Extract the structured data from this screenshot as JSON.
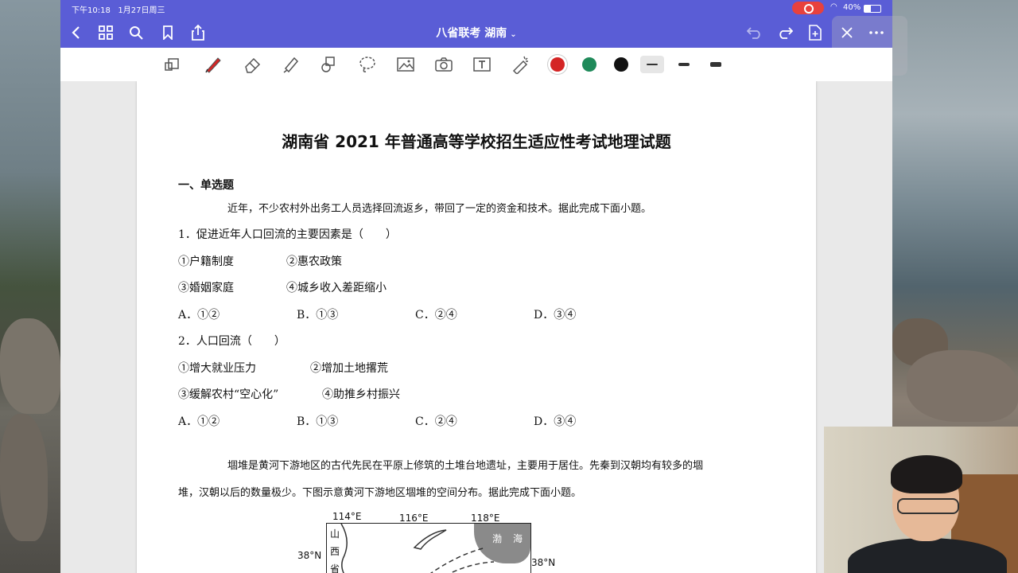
{
  "status": {
    "time": "下午10:18",
    "date": "1月27日周三",
    "battery": "40%"
  },
  "nav": {
    "title": "八省联考 湖南",
    "title_chevron": "⌄"
  },
  "toolbar": {
    "colors": {
      "red": "#d42525",
      "green": "#1f8a5a",
      "black": "#111111"
    }
  },
  "doc": {
    "title": "湖南省 2021 年普通高等学校招生适应性考试地理试题",
    "section1": "一、单选题",
    "intro1": "近年，不少农村外出务工人员选择回流返乡，带回了一定的资金和技术。据此完成下面小题。",
    "q1": {
      "stem": "1．促进近年人口回流的主要因素是（　　）",
      "items": [
        "①户籍制度",
        "②惠农政策",
        "③婚姻家庭",
        "④城乡收入差距缩小"
      ],
      "options": [
        "A．①②",
        "B．①③",
        "C．②④",
        "D．③④"
      ]
    },
    "q2": {
      "stem": "2．人口回流（　　）",
      "items": [
        "①增大就业压力",
        "②增加土地撂荒",
        "③缓解农村“空心化”",
        "④助推乡村振兴"
      ],
      "options": [
        "A．①②",
        "B．①③",
        "C．②④",
        "D．③④"
      ]
    },
    "intro2_line1": "堌堆是黄河下游地区的古代先民在平原上修筑的土堆台地遗址，主要用于居住。先秦到汉朝均有较多的堌",
    "intro2_line2": "堆，汉朝以后的数量极少。下图示意黄河下游地区堌堆的空间分布。据此完成下面小题。",
    "map": {
      "lon1": "114°E",
      "lon2": "116°E",
      "lon3": "118°E",
      "lat_left": "38°N",
      "lat_right": "38°N",
      "province": [
        "山",
        "西",
        "省"
      ],
      "sea": [
        "渤",
        "海"
      ]
    }
  }
}
